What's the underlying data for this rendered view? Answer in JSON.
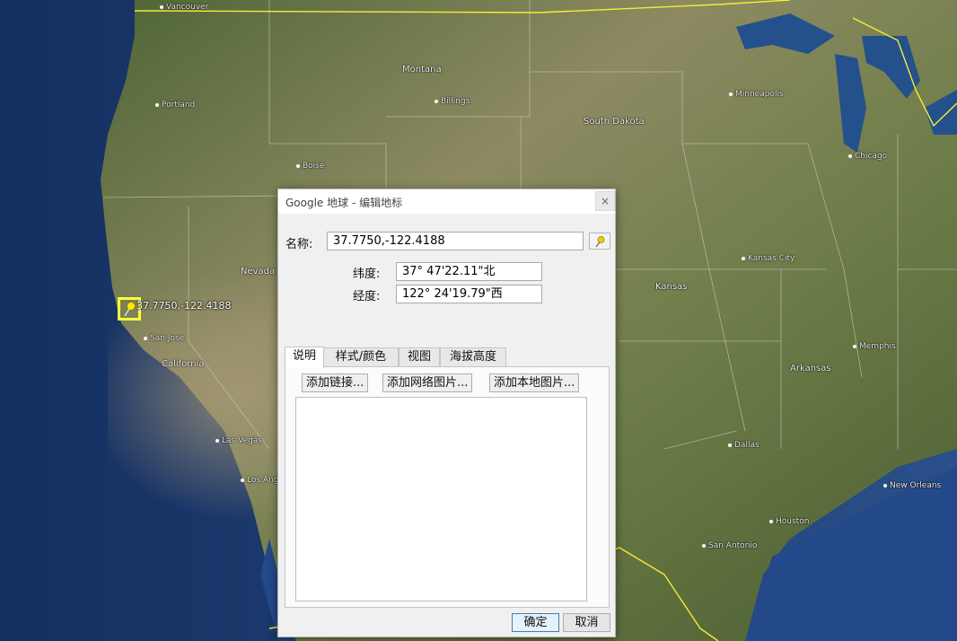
{
  "dialog": {
    "title": "Google 地球 - 编辑地标",
    "close_glyph": "×",
    "name_label": "名称:",
    "name_value": "37.7750,-122.4188",
    "lat_label": "纬度:",
    "lat_value": "37° 47'22.11\"北",
    "lon_label": "经度:",
    "lon_value": "122° 24'19.79\"西",
    "tabs": [
      {
        "label": "说明",
        "active": true
      },
      {
        "label": "样式/颜色"
      },
      {
        "label": "视图"
      },
      {
        "label": "海拔高度"
      }
    ],
    "buttons": {
      "add_link": "添加链接...",
      "add_web_image": "添加网络图片...",
      "add_local_image": "添加本地图片..."
    },
    "ok": "确定",
    "cancel": "取消",
    "description_value": ""
  },
  "map": {
    "placemark_label": "37.7750,-122.4188",
    "colors": {
      "ocean": "#1d3f78",
      "land": "#6b7a48",
      "border": "#f5ee34",
      "pin": "#ffff3a"
    }
  }
}
